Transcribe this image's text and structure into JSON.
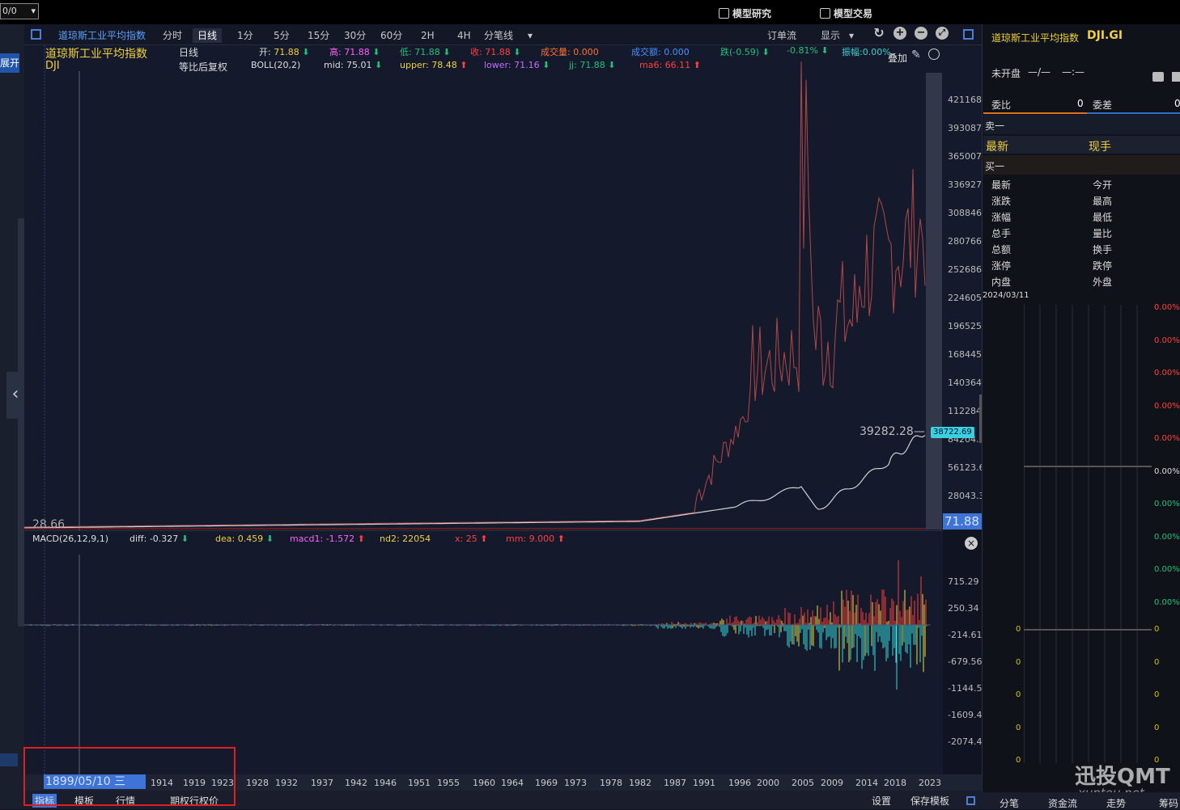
{
  "topbar": {
    "account": "0/0",
    "model_research": "模型研究",
    "model_trade": "模型交易"
  },
  "sidebar": {
    "expand": "展开"
  },
  "periods": [
    "分时",
    "日线",
    "1分",
    "5分",
    "15分",
    "30分",
    "60分",
    "2H",
    "4H",
    "分笔线"
  ],
  "period_active": "日线",
  "toolbar_right": {
    "order_flow": "订单流",
    "display": "显示",
    "overlay": "叠加"
  },
  "main": {
    "name": "道琼斯工业平均指数",
    "code": "DJI",
    "kline": "日线",
    "adjust": "等比后复权",
    "open_label": "开",
    "open": "71.88",
    "high_label": "高",
    "high": "71.88",
    "low_label": "低",
    "low": "71.88",
    "close_label": "收",
    "close": "71.88",
    "volume": "成交量: 0.000",
    "amount": "成交额: 0.000",
    "change": "跌(-0.59)",
    "change_pct": "-0.81%",
    "amplitude": "振幅:0.00%",
    "boll": "BOLL(20,2)",
    "mid": "mid: 75.01",
    "upper": "upper: 78.48",
    "lower": "lower: 71.16",
    "jj": "jj: 71.88",
    "ma6": "ma6: 66.11",
    "low_mark": "28.66",
    "peak_price": "39282.28",
    "last_price": "38722.69",
    "current": "71.88"
  },
  "y_ticks": [
    "421168.0",
    "393087.7",
    "365007.4",
    "336927.0",
    "308846.7",
    "280766.3",
    "252686.0",
    "224605.7",
    "196525.3",
    "168445.0",
    "140364.6",
    "112284.3",
    "84204.0",
    "56123.68",
    "28043.34"
  ],
  "macd": {
    "title": "MACD(26,12,9,1)",
    "diff": "diff: -0.327",
    "dea": "dea: 0.459",
    "macd1": "macd1: -1.572",
    "nd2": "nd2: 22054",
    "x": "x: 25",
    "mm": "mm: 9.000"
  },
  "macd_ticks": [
    "715.29",
    "250.34",
    "-214.61",
    "-679.56",
    "-1144.51",
    "-1609.47",
    "-2074.42"
  ],
  "x_selected": "1899/05/10 三",
  "x_ticks": [
    "1914",
    "1919",
    "1923",
    "1928",
    "1932",
    "1937",
    "1942",
    "1946",
    "1951",
    "1955",
    "1960",
    "1964",
    "1969",
    "1973",
    "1978",
    "1982",
    "1987",
    "1991",
    "1996",
    "2000",
    "2005",
    "2009",
    "2014",
    "2018",
    "2023"
  ],
  "bottom_tabs": [
    "指标",
    "模板",
    "行情",
    "期权行权价"
  ],
  "bottom_right": {
    "settings": "设置",
    "save_template": "保存模板"
  },
  "right": {
    "title": "道琼斯工业平均指数",
    "code": "DJI.GI",
    "status": "未开盘",
    "status_v1": "—/—",
    "status_v2": "—:—",
    "wei_bi": "委比",
    "wei_bi_v": "0",
    "wei_cha": "委差",
    "wei_cha_v": "0",
    "sell1": "卖一",
    "latest": "最新",
    "hand": "现手",
    "buy1": "买一",
    "fields_left": [
      "最新",
      "涨跌",
      "涨幅",
      "总手",
      "总额",
      "涨停",
      "内盘"
    ],
    "fields_right": [
      "今开",
      "最高",
      "最低",
      "量比",
      "换手",
      "跌停",
      "外盘"
    ],
    "date": "2024/03/11",
    "pct_labels": [
      "0.00%",
      "0.00%",
      "0.00%",
      "0.00%",
      "0.00%",
      "0.00%",
      "0.00%",
      "0.00%",
      "0.00%",
      "0.00%"
    ],
    "vol_labels": [
      "0",
      "0",
      "0",
      "0",
      "0"
    ],
    "tabs": [
      "分笔",
      "资金流",
      "走势",
      "筹码"
    ]
  },
  "watermark": {
    "brand": "迅投QMT",
    "url": "xuntou.net"
  },
  "colors": {
    "up": "#ff4040",
    "down": "#22c07a",
    "price_line": "#e8e8e8",
    "boll_upper": "#c04040",
    "macd_pos": "#ff3b3b",
    "macd_neg": "#33e0e0",
    "macd_yellow": "#f0e040"
  }
}
